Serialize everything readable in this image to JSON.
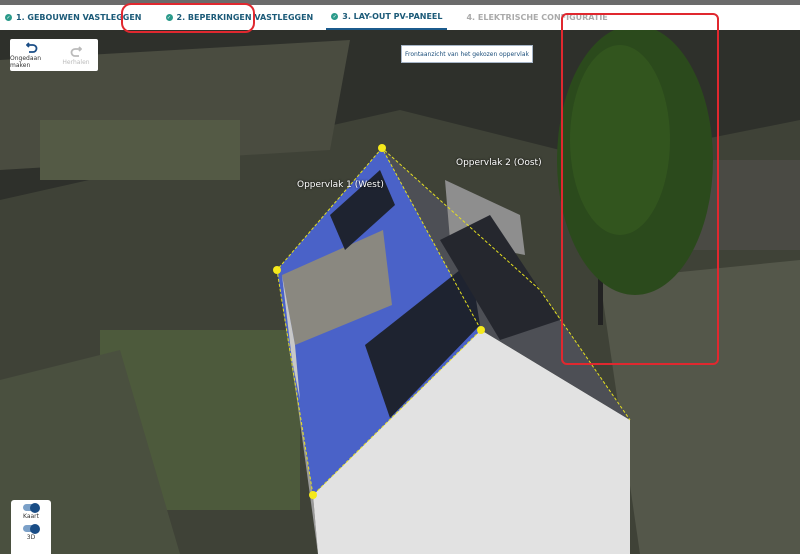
{
  "tabs": [
    {
      "label": "1. GEBOUWEN VASTLEGGEN",
      "status": "done"
    },
    {
      "label": "2. BEPERKINGEN VASTLEGGEN",
      "status": "done"
    },
    {
      "label": "3. LAY-OUT PV-PANEEL",
      "status": "active"
    },
    {
      "label": "4. ELEKTRISCHE CONFIGURATIE",
      "status": "disabled"
    }
  ],
  "toolbar": {
    "undo": "Ongedaan maken",
    "redo": "Herhalen"
  },
  "front_view_button": "Frontaanzicht van het gekozen oppervlak",
  "surfaces": {
    "west": "Oppervlak 1 (West)",
    "east": "Oppervlak 2 (Oost)"
  },
  "toggles": {
    "map": "Kaart",
    "three_d": "3D",
    "map_on": true,
    "three_d_on": true
  },
  "colors": {
    "accent": "#1b5a8c",
    "highlight": "#e0282f",
    "check": "#2a9a8a"
  }
}
